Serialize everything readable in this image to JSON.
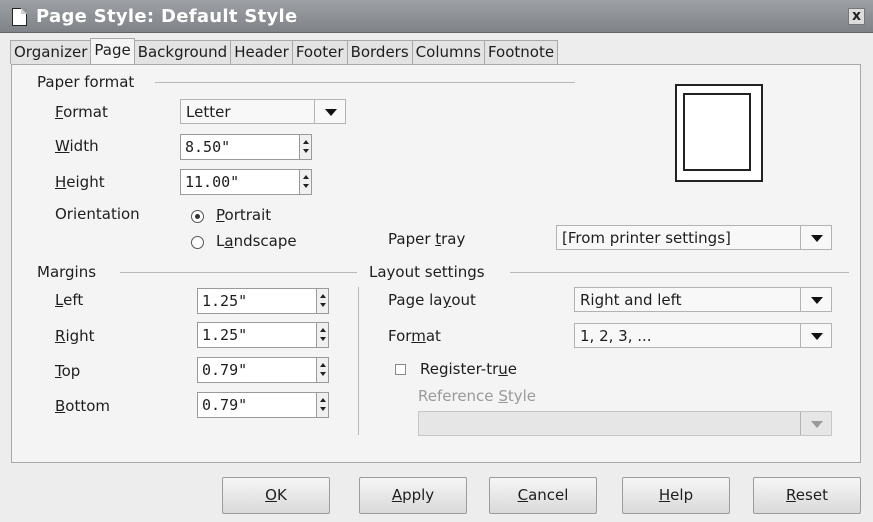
{
  "window": {
    "title": "Page Style: Default Style",
    "close_label": "x"
  },
  "tabs": [
    "Organizer",
    "Page",
    "Background",
    "Header",
    "Footer",
    "Borders",
    "Columns",
    "Footnote"
  ],
  "active_tab": "Page",
  "paper_format": {
    "section_label": "Paper format",
    "format": {
      "label_u": "F",
      "label_rest": "ormat",
      "value": "Letter"
    },
    "width": {
      "label_u": "W",
      "label_rest": "idth",
      "value": "8.50\""
    },
    "height": {
      "label_u": "H",
      "label_rest": "eight",
      "value": "11.00\""
    },
    "orientation": {
      "label": "Orientation",
      "portrait": {
        "label_u": "P",
        "label_rest": "ortrait",
        "selected": true
      },
      "landscape": {
        "label_pre": "L",
        "label_u": "a",
        "label_rest": "ndscape",
        "selected": false
      }
    },
    "paper_tray": {
      "label_pre": "Paper ",
      "label_u": "t",
      "label_rest": "ray",
      "value": "[From printer settings]"
    }
  },
  "margins": {
    "section_label": "Margins",
    "left": {
      "label_u": "L",
      "label_rest": "eft",
      "value": "1.25\""
    },
    "right": {
      "label_u": "R",
      "label_rest": "ight",
      "value": "1.25\""
    },
    "top": {
      "label_u": "T",
      "label_rest": "op",
      "value": "0.79\""
    },
    "bottom": {
      "label_u": "B",
      "label_rest": "ottom",
      "value": "0.79\""
    }
  },
  "layout_settings": {
    "section_label": "Layout settings",
    "page_layout": {
      "label_pre": "Page la",
      "label_u": "y",
      "label_rest": "out",
      "value": "Right and left"
    },
    "format": {
      "label_pre": "For",
      "label_u": "m",
      "label_rest": "at",
      "value": "1, 2, 3, ..."
    },
    "register_true": {
      "label_pre": "Register-tr",
      "label_u": "u",
      "label_rest": "e",
      "checked": false
    },
    "reference_style": {
      "label_pre": "Reference ",
      "label_u": "S",
      "label_rest": "tyle",
      "value": ""
    }
  },
  "buttons": {
    "ok": {
      "u": "O",
      "rest": "K"
    },
    "apply": {
      "pre": "",
      "u": "A",
      "rest": "pply"
    },
    "cancel": {
      "pre": "",
      "u": "C",
      "rest": "ancel"
    },
    "help": {
      "u": "H",
      "rest": "elp"
    },
    "reset": {
      "u": "R",
      "rest": "eset"
    }
  }
}
